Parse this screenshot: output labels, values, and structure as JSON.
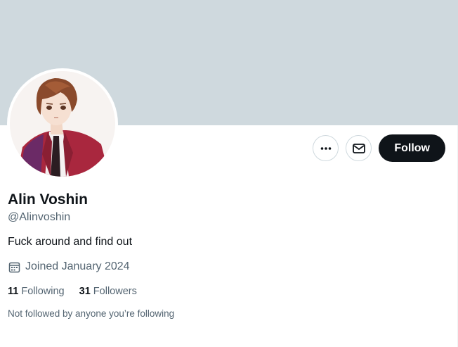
{
  "profile": {
    "display_name": "Alin Voshin",
    "handle": "@Alinvoshin",
    "bio": "Fuck around and find out",
    "joined": "Joined January 2024",
    "following_count": "11",
    "following_label": "Following",
    "followers_count": "31",
    "followers_label": "Followers",
    "mutuals_note": "Not followed by anyone you’re following"
  },
  "actions": {
    "follow_label": "Follow",
    "more_icon": "more-horizontal-icon",
    "message_icon": "envelope-icon"
  },
  "colors": {
    "banner": "#cfd9de",
    "primary_text": "#0f1419",
    "secondary_text": "#536471",
    "follow_bg": "#0f1419"
  }
}
